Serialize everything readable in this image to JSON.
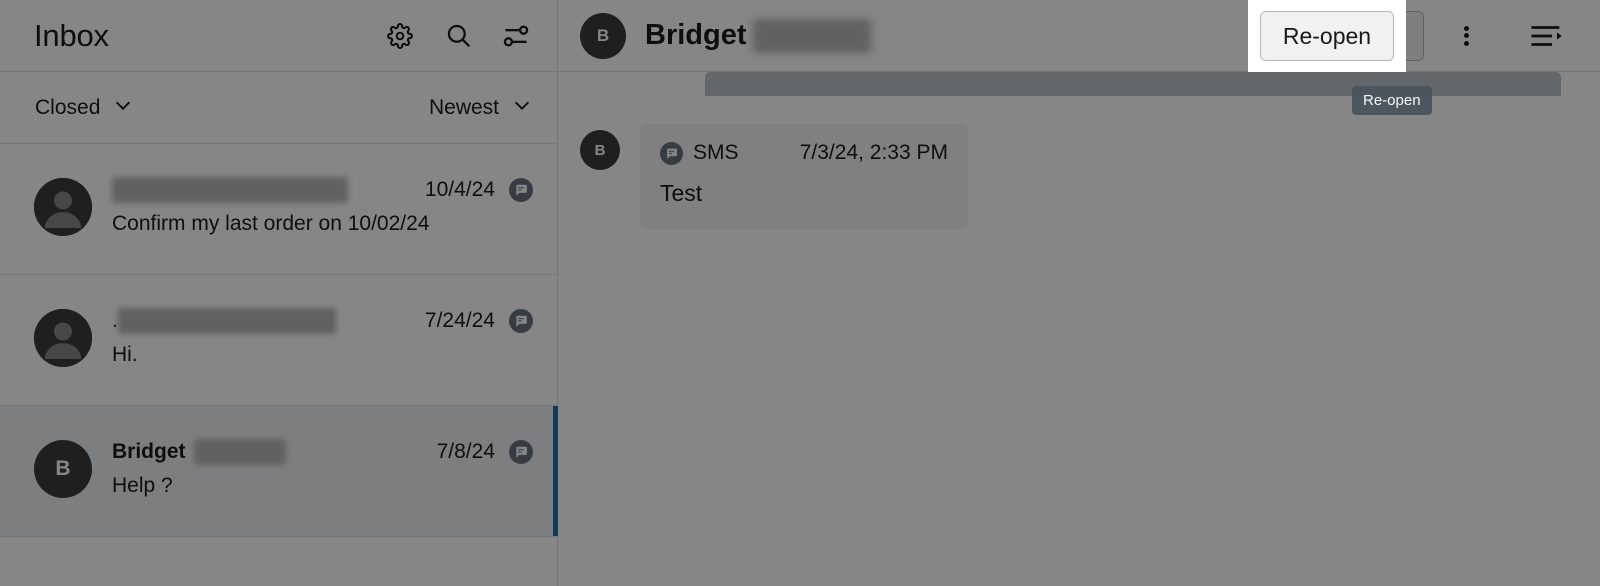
{
  "inbox": {
    "title": "Inbox",
    "icons": [
      {
        "name": "gear-icon",
        "label": "Settings"
      },
      {
        "name": "search-icon",
        "label": "Search"
      },
      {
        "name": "filter-sliders-icon",
        "label": "Filters"
      }
    ],
    "filters": {
      "status": {
        "label": "Closed",
        "chevron": "chevron-down-icon"
      },
      "sort": {
        "label": "Newest",
        "chevron": "chevron-down-icon"
      }
    },
    "conversations": [
      {
        "avatar_type": "person-silhouette",
        "initial": "",
        "name": "",
        "name_redacted": true,
        "redact_width": "w-lg",
        "bold": false,
        "date": "10/4/24",
        "channel": "sms-bubble-icon",
        "preview": "Confirm my last order on 10/02/24",
        "selected": false
      },
      {
        "avatar_type": "person-silhouette",
        "initial": "",
        "name": ".",
        "name_redacted": true,
        "redact_width": "w-md",
        "bold": false,
        "date": "7/24/24",
        "channel": "sms-bubble-icon",
        "preview": "Hi.",
        "selected": false
      },
      {
        "avatar_type": "initial",
        "initial": "B",
        "name": "Bridget",
        "name_redacted": true,
        "redact_width": "w-sm",
        "bold": true,
        "date": "7/8/24",
        "channel": "sms-bubble-icon",
        "preview": "Help ?",
        "selected": true
      }
    ]
  },
  "conversation": {
    "header": {
      "avatar_initial": "B",
      "title": "Bridget",
      "title_redacted": true,
      "reopen_label": "Re-open",
      "kebab_name": "more-options-icon",
      "list_icon_name": "conversation-details-icon"
    },
    "messages": [
      {
        "avatar_initial": "B",
        "channel": "SMS",
        "channel_icon": "sms-bubble-icon",
        "timestamp": "7/3/24, 2:33 PM",
        "text": "Test"
      }
    ]
  },
  "tooltip": {
    "text": "Re-open"
  },
  "colors": {
    "accent_selected": "#1f73a8",
    "avatar_bg": "#3b3b3b",
    "banner": "#b8c4c9",
    "tooltip_bg": "#49545c",
    "button_bg": "#f1f1f1",
    "bubble_bg": "#f3f3f3"
  }
}
